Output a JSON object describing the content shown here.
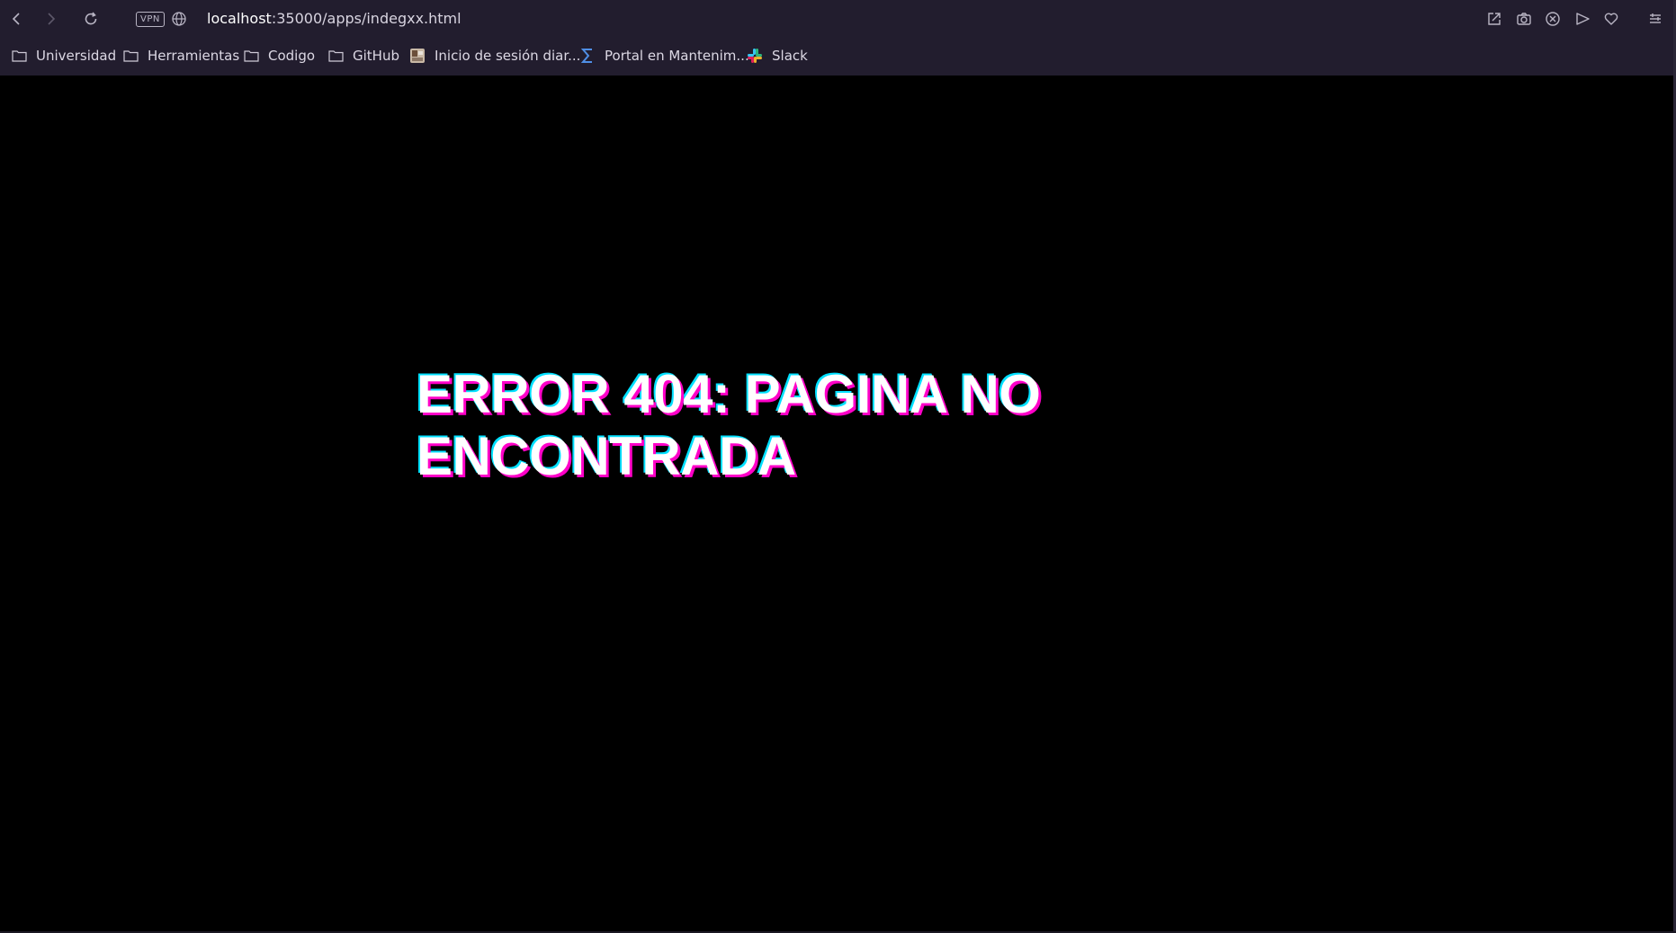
{
  "toolbar": {
    "vpn_label": "VPN",
    "url_host": "localhost",
    "url_path": ":35000/apps/indegxx.html",
    "icons": [
      "back-icon",
      "forward-icon",
      "reload-icon",
      "globe-icon",
      "share-icon",
      "camera-icon",
      "close-circle-icon",
      "send-icon",
      "heart-icon",
      "menu-icon"
    ]
  },
  "bookmarks": [
    {
      "label": "Universidad",
      "icon": "folder-icon"
    },
    {
      "label": "Herramientas",
      "icon": "folder-icon"
    },
    {
      "label": "Codigo",
      "icon": "folder-icon"
    },
    {
      "label": "GitHub",
      "icon": "folder-icon"
    },
    {
      "label": "Inicio de sesión diar...",
      "icon": "site-favicon"
    },
    {
      "label": "Portal en Mantenim...",
      "icon": "sigma-icon"
    },
    {
      "label": "Slack",
      "icon": "slack-icon"
    }
  ],
  "page": {
    "heading_line1": "ERROR 404: PAGINA NO",
    "heading_line2": "ENCONTRADA"
  },
  "colors": {
    "chrome_bg": "#221d2e",
    "page_bg": "#000000",
    "heading_text": "#ffffff",
    "glitch_magenta": "#ff00c8",
    "glitch_cyan": "#00e0ff"
  }
}
